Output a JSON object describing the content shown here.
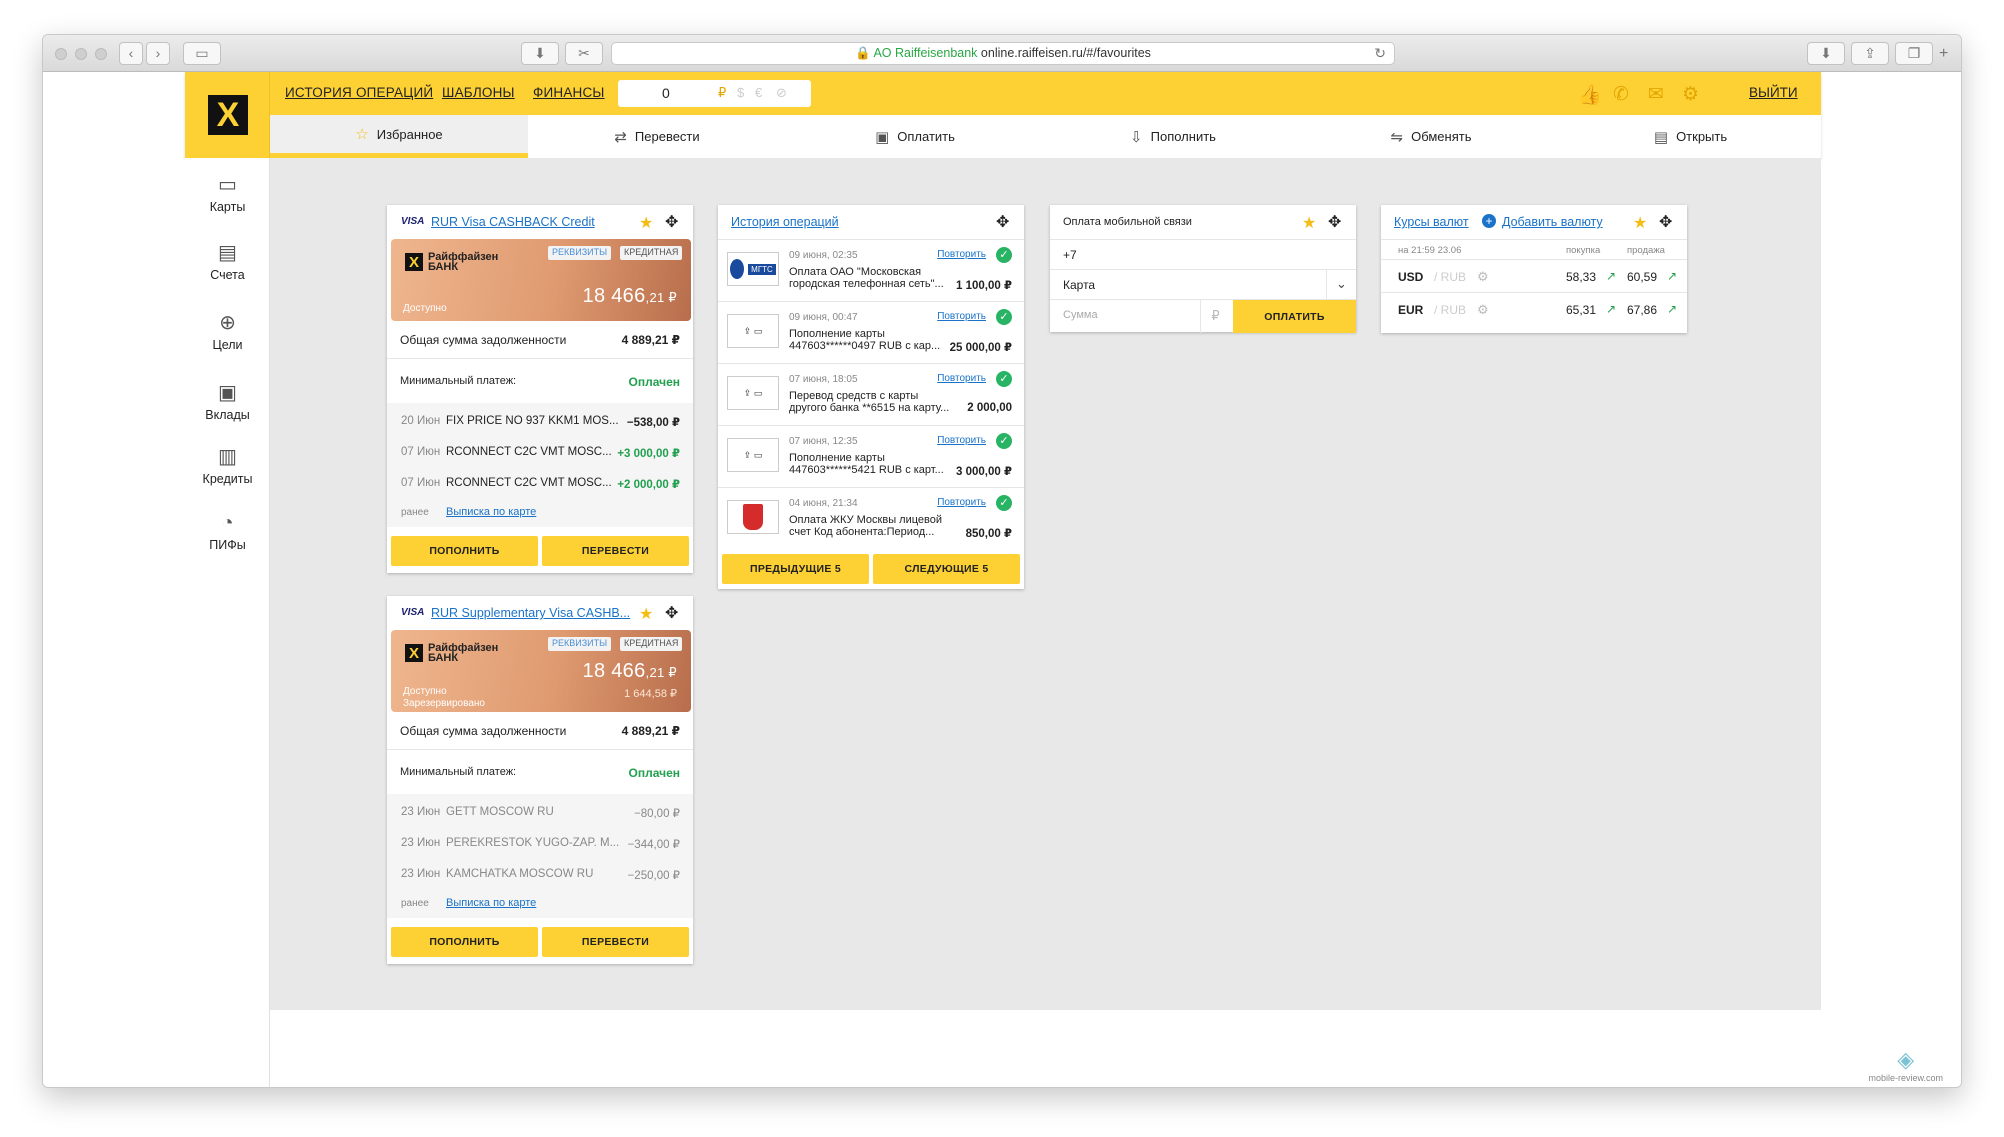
{
  "browser": {
    "url_org": "AO Raiffeisenbank",
    "url": "online.raiffeisen.ru/#/favourites"
  },
  "header": {
    "nav": [
      "ИСТОРИЯ ОПЕРАЦИЙ",
      "ШАБЛОНЫ",
      "ФИНАНСЫ"
    ],
    "balance": "0",
    "currencies": [
      "₽",
      "$",
      "€"
    ],
    "logout": "ВЫЙТИ",
    "tabs": [
      {
        "label": "Избранное",
        "icon": "star-icon"
      },
      {
        "label": "Перевести",
        "icon": "transfer-icon"
      },
      {
        "label": "Оплатить",
        "icon": "pay-icon"
      },
      {
        "label": "Пополнить",
        "icon": "topup-icon"
      },
      {
        "label": "Обменять",
        "icon": "exchange-icon"
      },
      {
        "label": "Открыть",
        "icon": "open-icon"
      }
    ]
  },
  "sidebar": [
    {
      "label": "Карты",
      "icon": "cards-icon"
    },
    {
      "label": "Счета",
      "icon": "accounts-icon"
    },
    {
      "label": "Цели",
      "icon": "target-icon"
    },
    {
      "label": "Вклады",
      "icon": "deposits-icon"
    },
    {
      "label": "Кредиты",
      "icon": "credits-icon"
    },
    {
      "label": "ПИФы",
      "icon": "funds-icon"
    }
  ],
  "card1": {
    "brand": "VISA",
    "title": "RUR Visa CASHBACK Credit",
    "bank_line1": "Райффайзен",
    "bank_line2": "БАНК",
    "badge_req": "РЕКВИЗИТЫ",
    "badge_type": "КРЕДИТНАЯ",
    "available_label": "Доступно",
    "amount_main": "18 466",
    "amount_cents": ",21 ₽",
    "debt_label": "Общая сумма задолженности",
    "debt_value": "4 889,21 ₽",
    "min_label": "Минимальный платеж:",
    "min_value": "Оплачен",
    "tx": [
      {
        "date": "20 Июн",
        "desc": "FIX PRICE NO 937 KKM1 MOS...",
        "amount": "−538,00 ₽"
      },
      {
        "date": "07 Июн",
        "desc": "RCONNECT C2C VMT MOSC...",
        "amount": "+3 000,00 ₽"
      },
      {
        "date": "07 Июн",
        "desc": "RCONNECT C2C VMT MOSC...",
        "amount": "+2 000,00 ₽"
      }
    ],
    "earlier": "ранее",
    "statement": "Выписка по карте",
    "btn_topup": "ПОПОЛНИТЬ",
    "btn_transfer": "ПЕРЕВЕСТИ"
  },
  "card2": {
    "brand": "VISA",
    "title": "RUR Supplementary Visa CASHB...",
    "bank_line1": "Райффайзен",
    "bank_line2": "БАНК",
    "badge_req": "РЕКВИЗИТЫ",
    "badge_type": "КРЕДИТНАЯ",
    "available_label": "Доступно",
    "reserved_label": "Зарезервировано",
    "amount_main": "18 466",
    "amount_cents": ",21 ₽",
    "reserved_value": "1 644,58 ₽",
    "debt_label": "Общая сумма задолженности",
    "debt_value": "4 889,21 ₽",
    "min_label": "Минимальный платеж:",
    "min_value": "Оплачен",
    "tx": [
      {
        "date": "23 Июн",
        "desc": "GETT MOSCOW RU",
        "amount": "−80,00 ₽"
      },
      {
        "date": "23 Июн",
        "desc": "PEREKRESTOK YUGO-ZAP. M...",
        "amount": "−344,00 ₽"
      },
      {
        "date": "23 Июн",
        "desc": "KAMCHATKA MOSCOW RU",
        "amount": "−250,00 ₽"
      }
    ],
    "earlier": "ранее",
    "statement": "Выписка по карте",
    "btn_topup": "ПОПОЛНИТЬ",
    "btn_transfer": "ПЕРЕВЕСТИ"
  },
  "history": {
    "title": "История операций",
    "repeat": "Повторить",
    "items": [
      {
        "date": "09 июня, 02:35",
        "line1": "Оплата ОАО \"Московская",
        "line2": "городская телефонная сеть\"...",
        "amount": "1 100,00 ₽",
        "logo": "МГТС"
      },
      {
        "date": "09 июня, 00:47",
        "line1": "Пополнение карты",
        "line2": "447603******0497 RUB с кар...",
        "amount": "25 000,00 ₽",
        "logo": "card"
      },
      {
        "date": "07 июня, 18:05",
        "line1": "Перевод средств с карты",
        "line2": "другого банка **6515 на карту...",
        "amount": "2 000,00",
        "logo": "card"
      },
      {
        "date": "07 июня, 12:35",
        "line1": "Пополнение карты",
        "line2": "447603******5421 RUB с карт...",
        "amount": "3 000,00 ₽",
        "logo": "card"
      },
      {
        "date": "04 июня, 21:34",
        "line1": "Оплата ЖКУ Москвы лицевой",
        "line2": "счет Код абонента:Период...",
        "amount": "850,00 ₽",
        "logo": "moscow"
      }
    ],
    "btn_prev": "ПРЕДЫДУЩИЕ 5",
    "btn_next": "СЛЕДУЮЩИЕ 5"
  },
  "mobile": {
    "title": "Оплата мобильной связи",
    "phone_prefix": "+7",
    "source": "Карта",
    "sum_placeholder": "Сумма",
    "currency": "₽",
    "pay": "ОПЛАТИТЬ"
  },
  "fx": {
    "title": "Курсы валют",
    "add": "Добавить валюту",
    "time": "на 21:59 23.06",
    "buy_label": "покупка",
    "sell_label": "продажа",
    "rows": [
      {
        "cur": "USD",
        "base": "/ RUB",
        "buy": "58,33",
        "sell": "60,59"
      },
      {
        "cur": "EUR",
        "base": "/ RUB",
        "buy": "65,31",
        "sell": "67,86"
      }
    ]
  },
  "watermark": "mobile-review.com",
  "colors": {
    "brand_yellow": "#fdd133",
    "link": "#1a73c8",
    "success": "#21a04f"
  }
}
